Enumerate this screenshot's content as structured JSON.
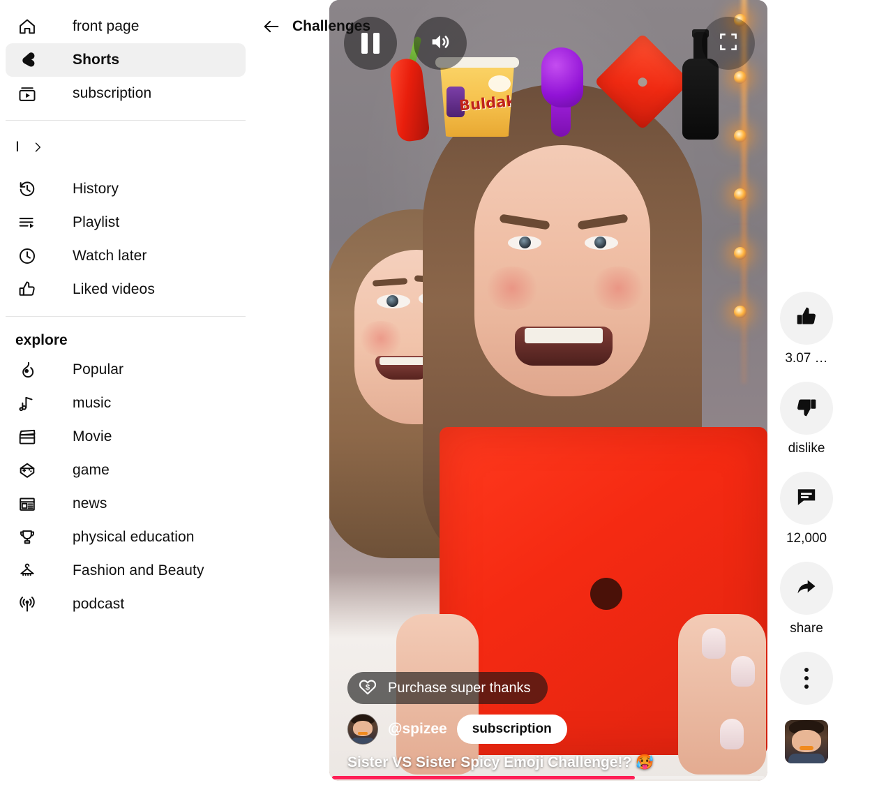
{
  "sidebar": {
    "primary": [
      {
        "label": "front page",
        "icon": "home-icon",
        "active": false
      },
      {
        "label": "Shorts",
        "icon": "shorts-icon",
        "active": true
      },
      {
        "label": "subscription",
        "icon": "subscriptions-icon",
        "active": false
      }
    ],
    "collapsed_row": {
      "label": "I",
      "chevron": "chevron-right-icon"
    },
    "library": [
      {
        "label": "History",
        "icon": "history-icon"
      },
      {
        "label": "Playlist",
        "icon": "playlist-icon"
      },
      {
        "label": "Watch later",
        "icon": "clock-icon"
      },
      {
        "label": "Liked videos",
        "icon": "thumbs-up-icon"
      }
    ],
    "explore_heading": "explore",
    "explore": [
      {
        "label": "Popular",
        "icon": "trending-icon"
      },
      {
        "label": "music",
        "icon": "music-note-icon"
      },
      {
        "label": "Movie",
        "icon": "clapperboard-icon"
      },
      {
        "label": "game",
        "icon": "gamepad-icon"
      },
      {
        "label": "news",
        "icon": "newspaper-icon"
      },
      {
        "label": "physical education",
        "icon": "trophy-icon"
      },
      {
        "label": "Fashion and Beauty",
        "icon": "hanger-icon"
      },
      {
        "label": "podcast",
        "icon": "podcast-icon"
      }
    ]
  },
  "header": {
    "back_icon": "back-arrow-icon",
    "title": "Challenges"
  },
  "player": {
    "controls": {
      "pause_icon": "pause-icon",
      "volume_icon": "volume-on-icon",
      "fullscreen_icon": "fullscreen-icon"
    },
    "progress_percent": 70,
    "progress_color": "#ff2056",
    "food_stickers": [
      "red-chili-pepper",
      "buldak-cup-noodle",
      "purple-chicken-drumstick",
      "red-spicy-cracker",
      "black-sauce-bottle"
    ],
    "noodle_brand": "Buldak",
    "overlay": {
      "super_thanks_label": "Purchase super thanks",
      "super_thanks_icon": "heart-dollar-icon",
      "channel_name": "@spizee",
      "subscribe_label": "subscription",
      "video_title": "Sister VS Sister Spicy Emoji Challenge!? 🥵",
      "avatar": "channel-avatar"
    }
  },
  "actions": [
    {
      "icon": "thumbs-up-icon",
      "label": "3.07 …",
      "name": "like"
    },
    {
      "icon": "thumbs-down-icon",
      "label": "dislike",
      "name": "dislike"
    },
    {
      "icon": "comment-icon",
      "label": "12,000",
      "name": "comments"
    },
    {
      "icon": "share-icon",
      "label": "share",
      "name": "share"
    },
    {
      "icon": "more-vertical-icon",
      "label": "",
      "name": "more"
    }
  ],
  "colors": {
    "accent": "#ff2056",
    "sidebar_active_bg": "#f0f0f0",
    "rail_circle_bg": "#f2f2f2",
    "text": "#0f0f0f"
  }
}
